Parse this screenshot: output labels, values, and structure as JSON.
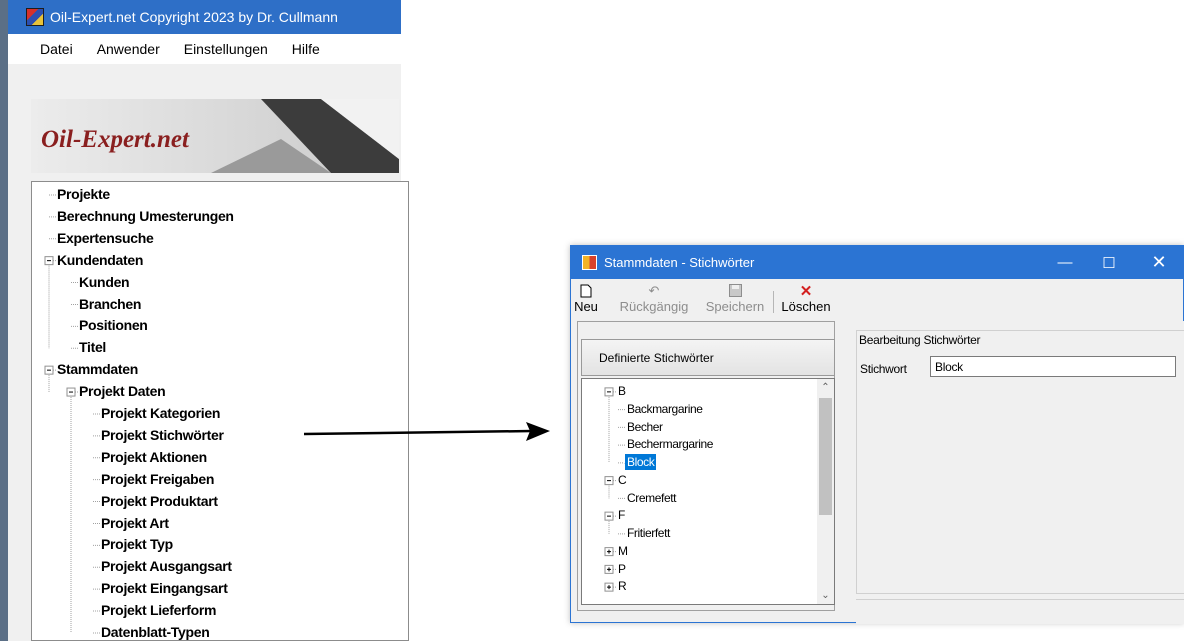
{
  "main_window": {
    "title": "Oil-Expert.net  Copyright 2023 by Dr. Cullmann",
    "menu": [
      "Datei",
      "Anwender",
      "Einstellungen",
      "Hilfe"
    ],
    "logo_text": "Oil-Expert.net",
    "nav_tree": [
      {
        "label": "Projekte",
        "level": 0,
        "expander": "none"
      },
      {
        "label": "Berechnung Umesterungen",
        "level": 0,
        "expander": "none"
      },
      {
        "label": "Expertensuche",
        "level": 0,
        "expander": "none"
      },
      {
        "label": "Kundendaten",
        "level": 0,
        "expander": "minus"
      },
      {
        "label": "Kunden",
        "level": 1,
        "expander": "none"
      },
      {
        "label": "Branchen",
        "level": 1,
        "expander": "none"
      },
      {
        "label": "Positionen",
        "level": 1,
        "expander": "none"
      },
      {
        "label": "Titel",
        "level": 1,
        "expander": "none"
      },
      {
        "label": "Stammdaten",
        "level": 0,
        "expander": "minus"
      },
      {
        "label": "Projekt Daten",
        "level": 1,
        "expander": "minus"
      },
      {
        "label": "Projekt Kategorien",
        "level": 2,
        "expander": "none"
      },
      {
        "label": "Projekt Stichwörter",
        "level": 2,
        "expander": "none"
      },
      {
        "label": "Projekt Aktionen",
        "level": 2,
        "expander": "none"
      },
      {
        "label": "Projekt Freigaben",
        "level": 2,
        "expander": "none"
      },
      {
        "label": "Projekt Produktart",
        "level": 2,
        "expander": "none"
      },
      {
        "label": "Projekt Art",
        "level": 2,
        "expander": "none"
      },
      {
        "label": "Projekt Typ",
        "level": 2,
        "expander": "none"
      },
      {
        "label": "Projekt Ausgangsart",
        "level": 2,
        "expander": "none"
      },
      {
        "label": "Projekt Eingangsart",
        "level": 2,
        "expander": "none"
      },
      {
        "label": "Projekt Lieferform",
        "level": 2,
        "expander": "none"
      },
      {
        "label": "Datenblatt-Typen",
        "level": 2,
        "expander": "none"
      }
    ]
  },
  "dialog": {
    "title": "Stammdaten - Stichwörter",
    "toolbar": [
      {
        "label": "Neu",
        "icon": "new-document-icon",
        "enabled": true
      },
      {
        "label": "Rückgängig",
        "icon": "undo-icon",
        "enabled": false
      },
      {
        "label": "Speichern",
        "icon": "save-icon",
        "enabled": false
      },
      {
        "label": "Löschen",
        "icon": "delete-icon",
        "enabled": true
      }
    ],
    "keywords_header": "Definierte Stichwörter",
    "keyword_tree": [
      {
        "label": "B",
        "level": 0,
        "expander": "minus"
      },
      {
        "label": "Backmargarine",
        "level": 1,
        "expander": "none"
      },
      {
        "label": "Becher",
        "level": 1,
        "expander": "none"
      },
      {
        "label": "Bechermargarine",
        "level": 1,
        "expander": "none"
      },
      {
        "label": "Block",
        "level": 1,
        "expander": "none",
        "selected": true
      },
      {
        "label": "C",
        "level": 0,
        "expander": "minus"
      },
      {
        "label": "Cremefett",
        "level": 1,
        "expander": "none"
      },
      {
        "label": "F",
        "level": 0,
        "expander": "minus"
      },
      {
        "label": "Fritierfett",
        "level": 1,
        "expander": "none"
      },
      {
        "label": "M",
        "level": 0,
        "expander": "plus"
      },
      {
        "label": "P",
        "level": 0,
        "expander": "plus"
      },
      {
        "label": "R",
        "level": 0,
        "expander": "plus"
      }
    ],
    "edit_group_title": "Bearbeitung Stichwörter",
    "keyword_label": "Stichwort",
    "keyword_value": "Block"
  },
  "colors": {
    "titlebar_blue": "#2b74d3",
    "selection_blue": "#0078d7",
    "delete_red": "#d32020",
    "logo_red": "#8a1f1f"
  }
}
